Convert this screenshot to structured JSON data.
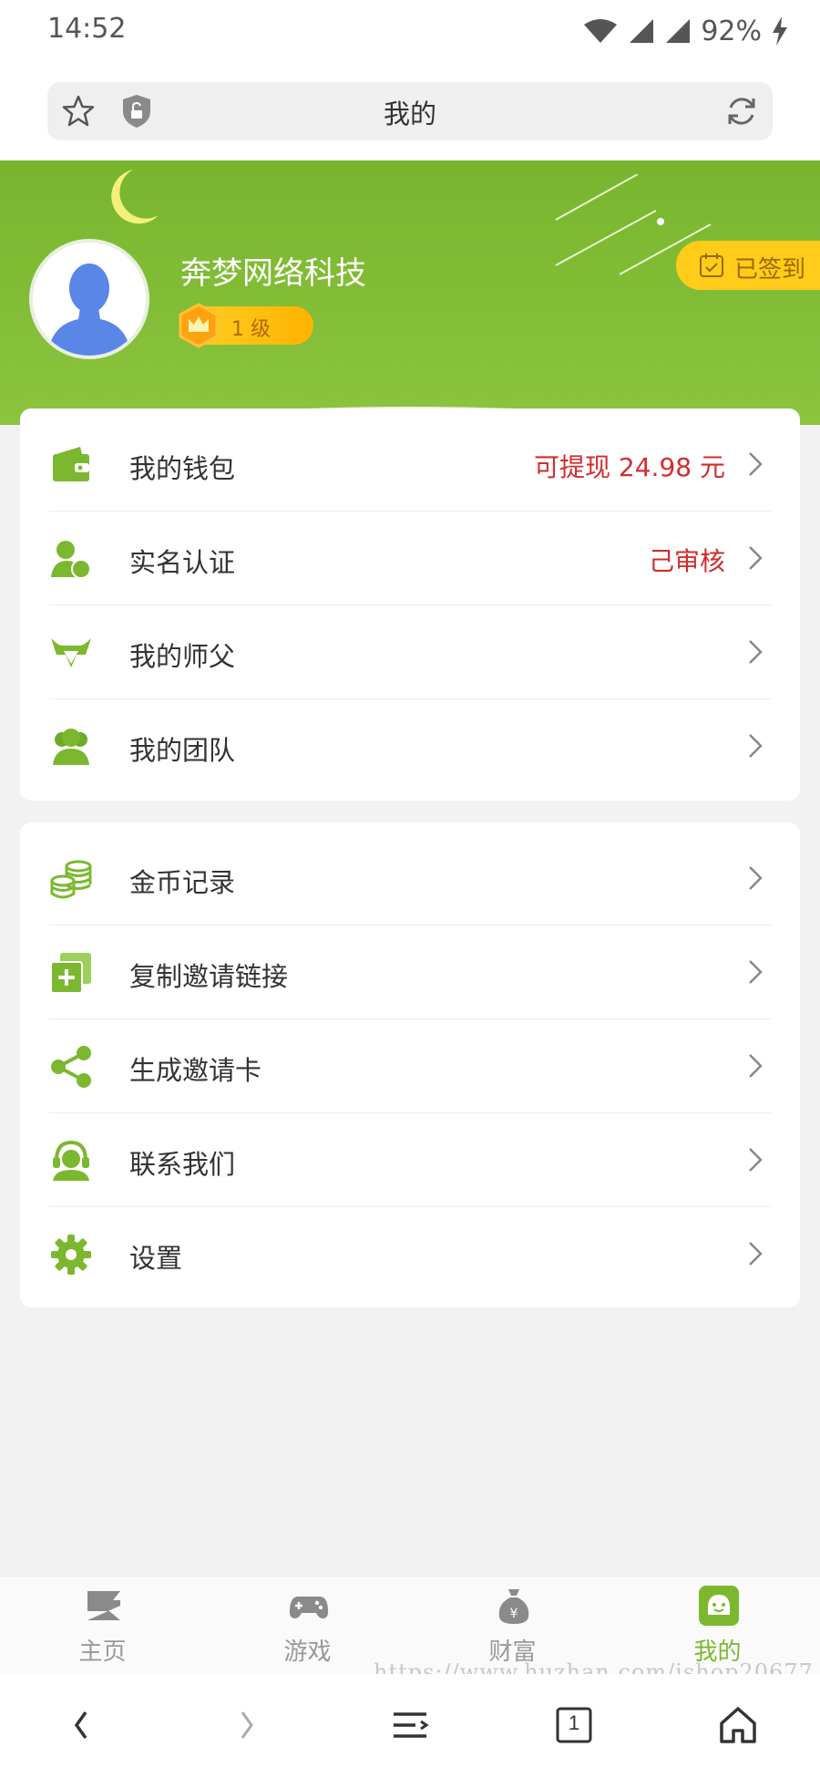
{
  "status_bar": {
    "time": "14:52",
    "battery": "92%"
  },
  "browser": {
    "page_title": "我的"
  },
  "profile": {
    "username": "奔梦网络科技",
    "level": "1 级",
    "signin_label": "已签到"
  },
  "menu_group_1": [
    {
      "icon": "wallet-icon",
      "label": "我的钱包",
      "value": "可提现 24.98 元"
    },
    {
      "icon": "verified-user-icon",
      "label": "实名认证",
      "value": "己审核"
    },
    {
      "icon": "mentor-icon",
      "label": "我的师父",
      "value": ""
    },
    {
      "icon": "team-icon",
      "label": "我的团队",
      "value": ""
    }
  ],
  "menu_group_2": [
    {
      "icon": "coins-icon",
      "label": "金币记录"
    },
    {
      "icon": "copy-link-icon",
      "label": "复制邀请链接"
    },
    {
      "icon": "share-icon",
      "label": "生成邀请卡"
    },
    {
      "icon": "customer-service-icon",
      "label": "联系我们"
    },
    {
      "icon": "gear-icon",
      "label": "设置"
    }
  ],
  "bottom_nav": [
    {
      "icon": "home-icon",
      "label": "主页",
      "active": false
    },
    {
      "icon": "gamepad-icon",
      "label": "游戏",
      "active": false
    },
    {
      "icon": "money-bag-icon",
      "label": "财富",
      "active": false
    },
    {
      "icon": "mine-icon",
      "label": "我的",
      "active": true
    }
  ],
  "watermark": "https://www.huzhan.com/ishop20677",
  "browser_toolbar": {
    "tab_count": "1"
  },
  "colors": {
    "accent_green": "#7cb82f",
    "value_red": "#d22d2d",
    "signin_yellow": "#ffcc1a"
  }
}
